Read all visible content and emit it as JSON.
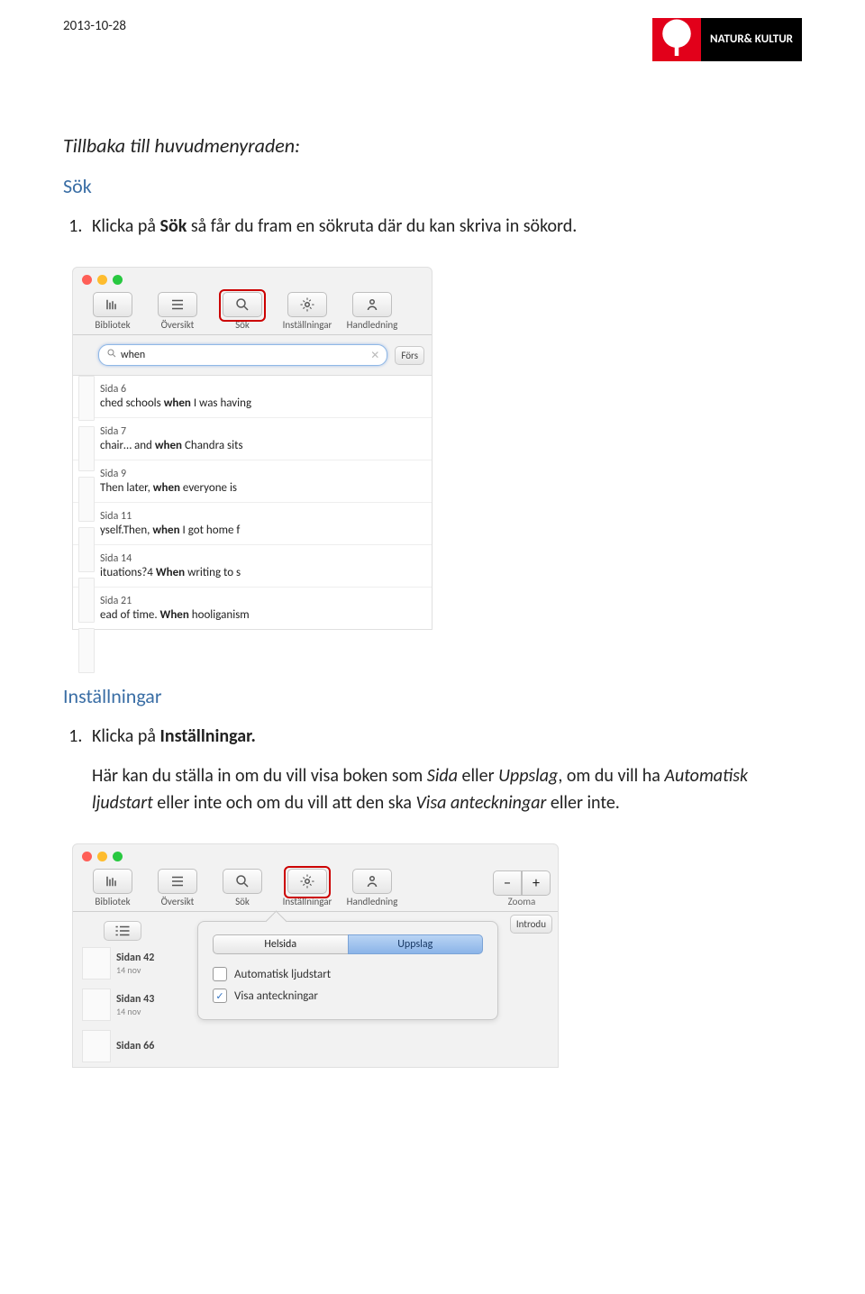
{
  "header": {
    "date": "2013-10-28",
    "brand": "NATUR& KULTUR"
  },
  "section1": {
    "intro_italic": "Tillbaka till huvudmenyraden:",
    "title": "Sök",
    "step_pre": "Klicka på ",
    "step_bold": "Sök",
    "step_post": " så får du fram en sökruta där du kan skriva in sökord."
  },
  "toolbar": {
    "bibliotek": "Bibliotek",
    "oversikt": "Översikt",
    "sok": "Sök",
    "installningar": "Inställningar",
    "handledning": "Handledning",
    "zooma": "Zooma"
  },
  "search": {
    "value": "when",
    "right_btn": "Förs",
    "results": [
      {
        "page": "Sida 6",
        "text_pre": "ched schools ",
        "text_b": "when",
        "text_post": " I was having"
      },
      {
        "page": "Sida 7",
        "text_pre": "chair… and ",
        "text_b": "when",
        "text_post": " Chandra sits"
      },
      {
        "page": "Sida 9",
        "text_pre": "Then later, ",
        "text_b": "when",
        "text_post": " everyone is"
      },
      {
        "page": "Sida 11",
        "text_pre": "yself.Then, ",
        "text_b": "when",
        "text_post": " I got home f"
      },
      {
        "page": "Sida 14",
        "text_pre": "ituations?4 ",
        "text_b": "When",
        "text_post": " writing to s"
      },
      {
        "page": "Sida 21",
        "text_pre": "ead of time. ",
        "text_b": "When",
        "text_post": " hooliganism"
      }
    ]
  },
  "section2": {
    "title": "Inställningar",
    "step_pre": "Klicka på ",
    "step_bold": "Inställningar.",
    "para_pre": "Här kan du ställa in om du vill visa boken som ",
    "para_i1": "Sida",
    "para_mid1": " eller ",
    "para_i2": "Uppslag",
    "para_mid2": ", om du vill ha ",
    "para_i3": "Automatisk ljudstart",
    "para_mid3": " eller inte och om du vill att den ska ",
    "para_i4": "Visa anteckningar",
    "para_post": " eller inte."
  },
  "settings": {
    "intro_btn": "Introdu",
    "seg_helsida": "Helsida",
    "seg_uppslag": "Uppslag",
    "chk_auto": "Automatisk ljudstart",
    "chk_notes": "Visa anteckningar",
    "thumbs": [
      {
        "t1": "Sidan 42",
        "t2": "14 nov"
      },
      {
        "t1": "Sidan 43",
        "t2": "14 nov"
      },
      {
        "t1": "Sidan 66",
        "t2": ""
      }
    ]
  }
}
